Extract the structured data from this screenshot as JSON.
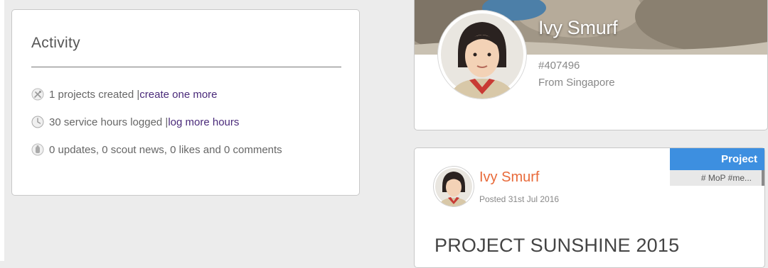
{
  "activity": {
    "title": "Activity",
    "rows": [
      {
        "icon": "tools-icon",
        "text": "1 projects created | ",
        "link": "create one more"
      },
      {
        "icon": "clock-icon",
        "text": "30 service hours logged | ",
        "link": "log more hours"
      },
      {
        "icon": "thumbs-icon",
        "text": "0 updates, 0 scout news, 0 likes and 0 comments"
      }
    ]
  },
  "profile": {
    "name": "Ivy Smurf",
    "id": "#407496",
    "from": "From Singapore"
  },
  "post": {
    "badge": "Project",
    "tags": "# MoP #me...",
    "author": "Ivy Smurf",
    "date": "Posted 31st Jul 2016",
    "title": "PROJECT SUNSHINE 2015"
  },
  "colors": {
    "background": "#ececec",
    "link": "#4a2a7a",
    "author": "#e86a3a",
    "badge": "#3d8fe0"
  }
}
